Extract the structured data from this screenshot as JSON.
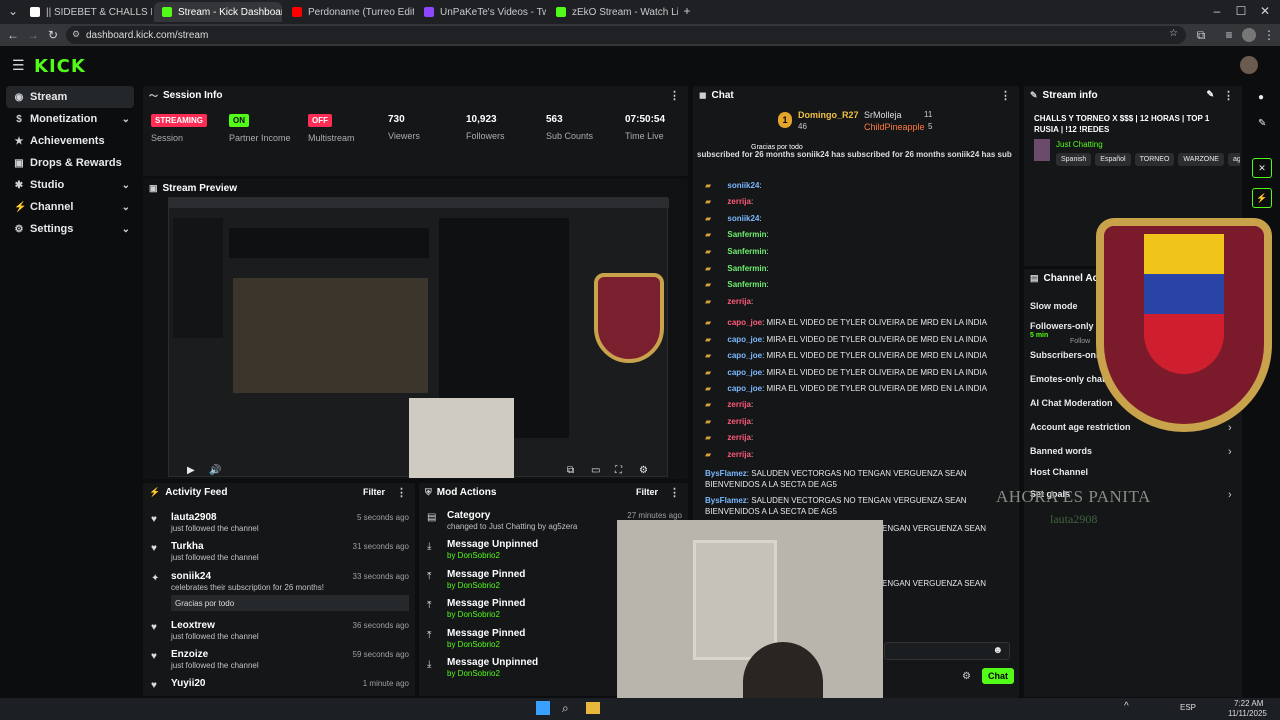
{
  "colors": {
    "accent": "#53fc18",
    "streaming": "#ff2d55",
    "off": "#ff2d55",
    "partner": "#53fc18"
  },
  "tabs": [
    {
      "label": "|| SIDEBET & CHALLS LATAM PL",
      "icon": "x-icon",
      "color": "#ffffff"
    },
    {
      "label": "Stream - Kick Dashboard",
      "icon": "kick-icon",
      "color": "#53fc18"
    },
    {
      "label": "Perdoname (Turreo Edit) || Blar",
      "icon": "youtube-icon",
      "color": "#ff0000"
    },
    {
      "label": "UnPaKeTe's Videos - Twitch",
      "icon": "twitch-icon",
      "color": "#9146ff"
    },
    {
      "label": "zEkO Stream - Watch Live on K",
      "icon": "kick-icon",
      "color": "#53fc18"
    }
  ],
  "address": "dashboard.kick.com/stream",
  "logo": "KICK",
  "sidebar": [
    {
      "label": "Stream",
      "icon": "stream-icon",
      "chev": ""
    },
    {
      "label": "Monetization",
      "icon": "dollar-icon",
      "chev": "⌄"
    },
    {
      "label": "Achievements",
      "icon": "star-icon",
      "chev": ""
    },
    {
      "label": "Drops & Rewards",
      "icon": "gift-icon",
      "chev": ""
    },
    {
      "label": "Studio",
      "icon": "gear-icon",
      "chev": "⌄"
    },
    {
      "label": "Channel",
      "icon": "bolt-icon",
      "chev": "⌄"
    },
    {
      "label": "Settings",
      "icon": "settings-icon",
      "chev": "⌄"
    }
  ],
  "session": {
    "title": "Session Info",
    "stats": [
      {
        "badge": "STREAMING",
        "label": "Session",
        "badge_color": "#ff2d55"
      },
      {
        "badge": "ON",
        "label": "Partner Income",
        "badge_color": "#53fc18"
      },
      {
        "badge": "OFF",
        "label": "Multistream",
        "badge_color": "#ff2d55"
      },
      {
        "value": "730",
        "label": "Viewers"
      },
      {
        "value": "10,923",
        "label": "Followers"
      },
      {
        "value": "563",
        "label": "Sub Counts"
      },
      {
        "value": "07:50:54",
        "label": "Time Live"
      }
    ]
  },
  "preview": {
    "title": "Stream Preview"
  },
  "activity": {
    "title": "Activity Feed",
    "filter": "Filter",
    "items": [
      {
        "name": "lauta2908",
        "sub": "just followed the channel",
        "time": "5 seconds ago",
        "icon": "heart-icon"
      },
      {
        "name": "Turkha",
        "sub": "just followed the channel",
        "time": "31 seconds ago",
        "icon": "heart-icon"
      },
      {
        "name": "soniik24",
        "sub": "celebrates their subscription for 26 months!",
        "time": "33 seconds ago",
        "icon": "star-icon",
        "message": "Gracias por todo"
      },
      {
        "name": "Leoxtrew",
        "sub": "just followed the channel",
        "time": "36 seconds ago",
        "icon": "heart-icon"
      },
      {
        "name": "Enzoize",
        "sub": "just followed the channel",
        "time": "59 seconds ago",
        "icon": "heart-icon"
      },
      {
        "name": "Yuyii20",
        "sub": "",
        "time": "1 minute ago",
        "icon": "heart-icon"
      }
    ]
  },
  "mod": {
    "title": "Mod Actions",
    "filter": "Filter",
    "items": [
      {
        "name": "Category",
        "sub": "changed to Just Chatting by ag5zera",
        "time": "27 minutes ago",
        "icon": "category-icon"
      },
      {
        "name": "Message Unpinned",
        "sub": "by DonSobrio2",
        "icon": "unpin-icon"
      },
      {
        "name": "Message Pinned",
        "sub": "by DonSobrio2",
        "icon": "pin-icon"
      },
      {
        "name": "Message Pinned",
        "sub": "by DonSobrio2",
        "icon": "pin-icon"
      },
      {
        "name": "Message Pinned",
        "sub": "by DonSobrio2",
        "icon": "pin-icon"
      },
      {
        "name": "Message Unpinned",
        "sub": "by DonSobrio2",
        "icon": "unpin-icon"
      }
    ]
  },
  "chat": {
    "title": "Chat",
    "leader": {
      "rank": "1",
      "user": "Domingo_R27",
      "count": "46",
      "second": "SrMolleja",
      "second_count": "11",
      "third": "ChildPineapple",
      "third_count": "5"
    },
    "ticker": "subscribed for 26 months   soniik24 has subscribed for 26 months   soniik24 has sub",
    "pinned": "Gracias por todo",
    "messages": [
      {
        "user": "soniik24",
        "text": ":",
        "cls": "b"
      },
      {
        "user": "zerrija",
        "text": ":",
        "cls": "r"
      },
      {
        "user": "soniik24",
        "text": ":",
        "cls": "b"
      },
      {
        "user": "Sanfermin",
        "text": ":",
        "cls": "g"
      },
      {
        "user": "Sanfermin",
        "text": ":",
        "cls": "g"
      },
      {
        "user": "Sanfermin",
        "text": ":",
        "cls": "g"
      },
      {
        "user": "Sanfermin",
        "text": ":",
        "cls": "g"
      },
      {
        "user": "zerrija",
        "text": ":",
        "cls": "r"
      },
      {
        "user": "capo_joe",
        "text": ": MIRA EL VIDEO DE TYLER OLIVEIRA DE MRD EN LA INDIA",
        "cls": "r"
      },
      {
        "user": "capo_joe",
        "text": ": MIRA EL VIDEO DE TYLER OLIVEIRA DE MRD EN LA INDIA",
        "cls": "b"
      },
      {
        "user": "capo_joe",
        "text": ": MIRA EL VIDEO DE TYLER OLIVEIRA DE MRD EN LA INDIA",
        "cls": "b"
      },
      {
        "user": "capo_joe",
        "text": ": MIRA EL VIDEO DE TYLER OLIVEIRA DE MRD EN LA INDIA",
        "cls": "b"
      },
      {
        "user": "capo_joe",
        "text": ": MIRA EL VIDEO DE TYLER OLIVEIRA DE MRD EN LA INDIA",
        "cls": "b"
      },
      {
        "user": "zerrija",
        "text": ":",
        "cls": "r"
      },
      {
        "user": "zerrija",
        "text": ":",
        "cls": "r"
      },
      {
        "user": "zerrija",
        "text": ":",
        "cls": "r"
      },
      {
        "user": "zerrija",
        "text": ":",
        "cls": "r"
      }
    ],
    "long_user": "BysFlamez",
    "long_text_1": ": SALUDEN VECTORGAS NO TENGAN VERGUENZA SEAN",
    "long_text_2": "BIENVENIDOS A LA SECTA DE AG5",
    "partial_1": "ENGAN VERGUENZA SEAN",
    "partial_2": "ENGAN VERGUENZA SEAN",
    "send": "Chat"
  },
  "stream_info": {
    "title": "Stream info",
    "headline": "CHALLS Y TORNEO X $$$ | 12 HORAS | TOP 1 RUSIA | !12 !REDES",
    "category": "Just Chatting",
    "tags": [
      "Spanish",
      "Español",
      "TORNEO",
      "WARZONE",
      "ag"
    ]
  },
  "channel_actions": {
    "title": "Channel Acti",
    "items": [
      "Slow mode",
      "Followers-only c",
      "Subscribers-only",
      "Emotes-only chat",
      "AI Chat Moderation",
      "Account age restriction",
      "Banned words",
      "Host Channel",
      "Set goals"
    ],
    "followers_sub": "5 min",
    "tooltip": "Follow"
  },
  "overlay": {
    "text": "AHORA ES PANITA",
    "user": "lauta2908"
  },
  "taskbar": {
    "lang": "ESP",
    "time": "7:22 AM",
    "date": "11/11/2025"
  }
}
